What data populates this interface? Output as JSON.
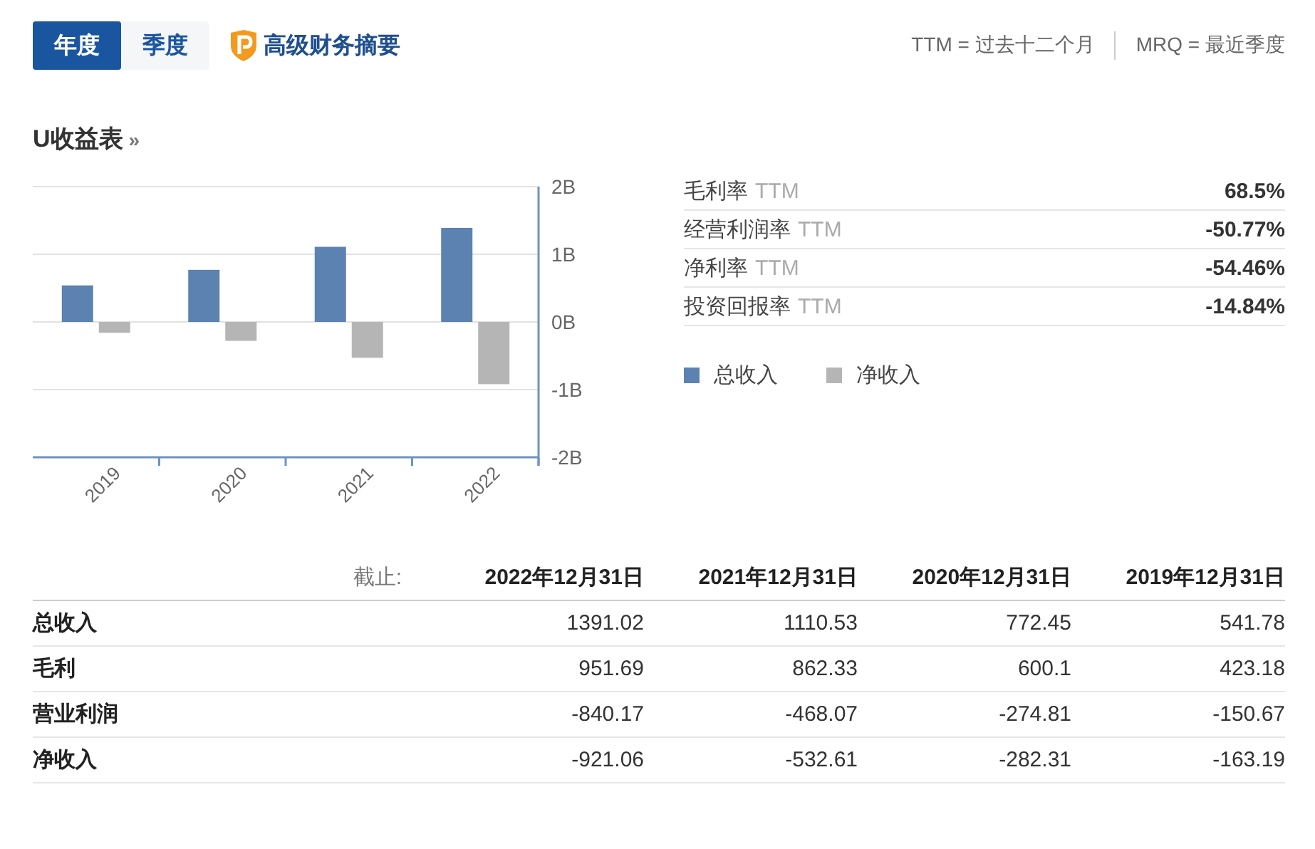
{
  "tabs": [
    {
      "label": "年度",
      "selected": true
    },
    {
      "label": "季度",
      "selected": false
    }
  ],
  "premium_link": "高级财务摘要",
  "legend_note": [
    {
      "text": "TTM = 过去十二个月"
    },
    {
      "text": "MRQ = 最近季度"
    }
  ],
  "section_title": "U收益表",
  "section_more": "»",
  "metrics": [
    {
      "label": "毛利率",
      "period": "TTM",
      "value": "68.5%"
    },
    {
      "label": "经营利润率",
      "period": "TTM",
      "value": "-50.77%"
    },
    {
      "label": "净利率",
      "period": "TTM",
      "value": "-54.46%"
    },
    {
      "label": "投资回报率",
      "period": "TTM",
      "value": "-14.84%"
    }
  ],
  "chart_data": {
    "type": "bar",
    "categories": [
      "2019",
      "2020",
      "2021",
      "2022"
    ],
    "series": [
      {
        "name": "总收入",
        "color": "#5b82b0",
        "values": [
          0.54,
          0.77,
          1.11,
          1.39
        ]
      },
      {
        "name": "净收入",
        "color": "#b5b5b5",
        "values": [
          -0.16,
          -0.28,
          -0.53,
          -0.92
        ]
      }
    ],
    "grid": true,
    "ylim": [
      -2,
      2
    ],
    "yticks": [
      {
        "value": 2,
        "label": "2B"
      },
      {
        "value": 1,
        "label": "1B"
      },
      {
        "value": 0,
        "label": "0B"
      },
      {
        "value": -1,
        "label": "-1B"
      },
      {
        "value": -2,
        "label": "-2B"
      }
    ]
  },
  "table": {
    "as_of_label": "截止:",
    "columns": [
      "2022年12月31日",
      "2021年12月31日",
      "2020年12月31日",
      "2019年12月31日"
    ],
    "rows": [
      {
        "label": "总收入",
        "values": [
          "1391.02",
          "1110.53",
          "772.45",
          "541.78"
        ]
      },
      {
        "label": "毛利",
        "values": [
          "951.69",
          "862.33",
          "600.1",
          "423.18"
        ]
      },
      {
        "label": "营业利润",
        "values": [
          "-840.17",
          "-468.07",
          "-274.81",
          "-150.67"
        ]
      },
      {
        "label": "净收入",
        "values": [
          "-921.06",
          "-532.61",
          "-282.31",
          "-163.19"
        ]
      }
    ]
  }
}
